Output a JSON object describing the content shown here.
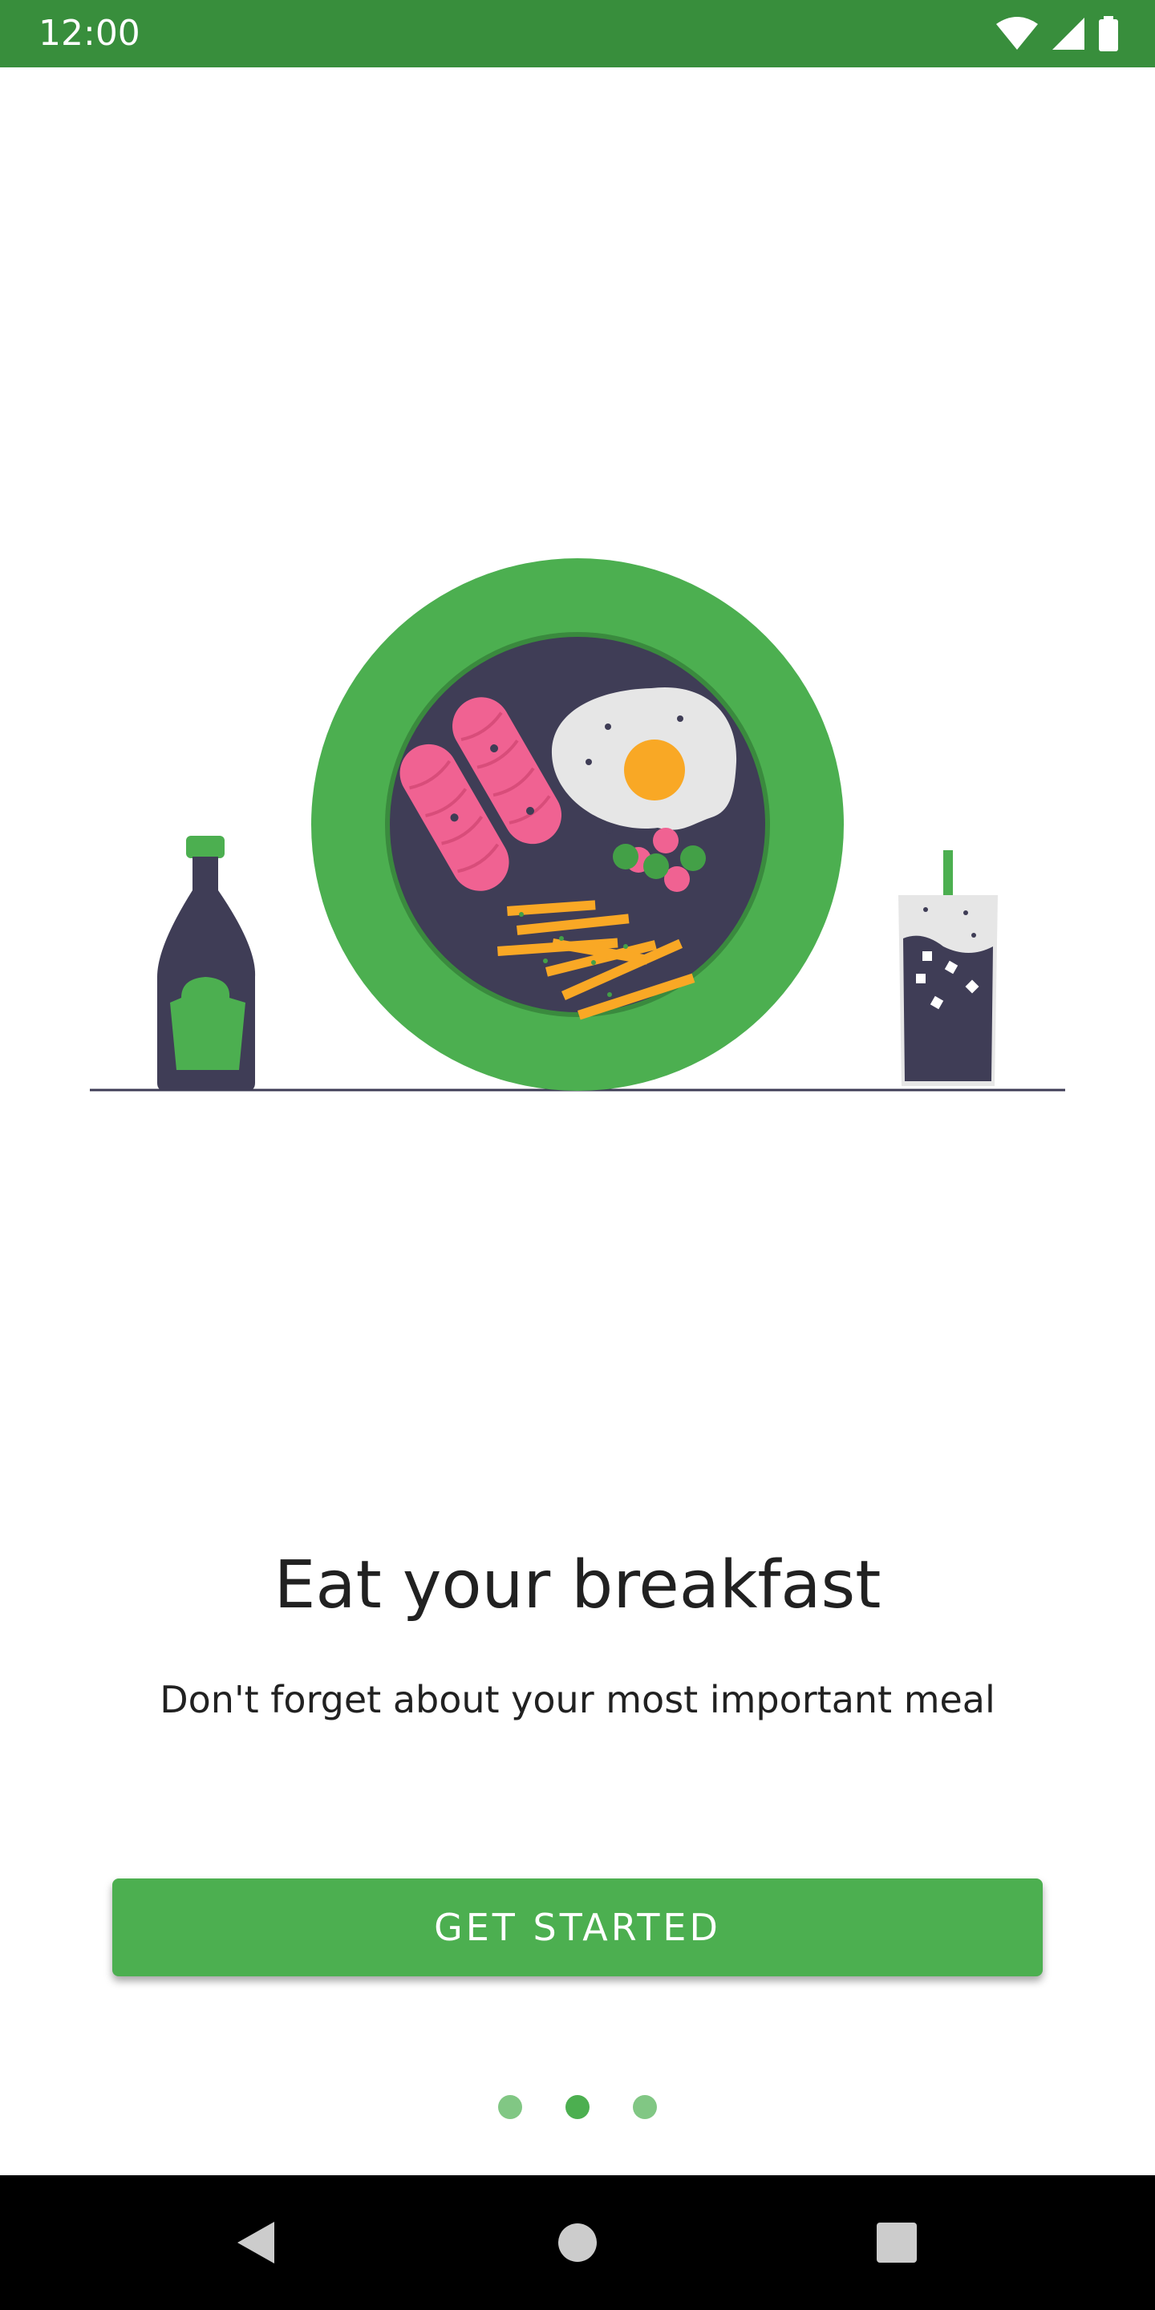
{
  "status_bar": {
    "time": "12:00",
    "background": "#388e3c",
    "icons": [
      "wifi-icon",
      "signal-icon",
      "battery-icon"
    ]
  },
  "onboarding": {
    "title": "Eat your breakfast",
    "subtitle": "Don't forget about your most important meal",
    "cta_label": "GET STARTED",
    "page_count": 3,
    "current_page": 2
  },
  "illustration": {
    "description_icon": "breakfast-plate-illustration",
    "accent_color": "#4caf50",
    "dark_color": "#3f3d56"
  },
  "nav_bar": {
    "icons": [
      "back-icon",
      "home-icon",
      "recents-icon"
    ]
  },
  "colors": {
    "primary": "#4caf50",
    "primary_dark": "#388e3c",
    "indicator_inactive": "#81c784",
    "text": "#212121"
  }
}
